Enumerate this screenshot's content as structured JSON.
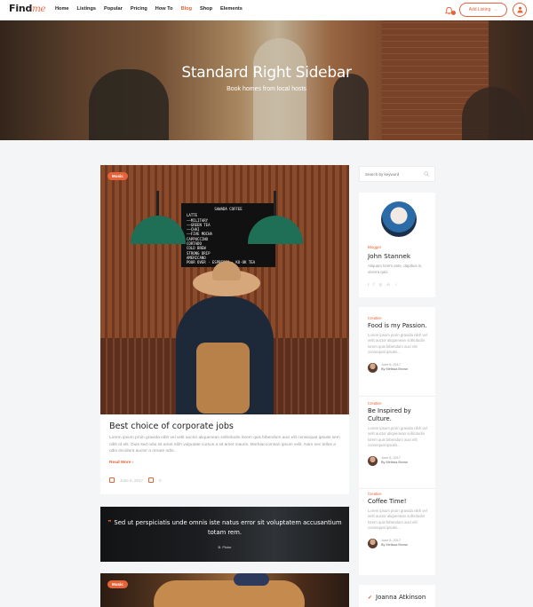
{
  "nav": {
    "logo_main": "Find",
    "logo_accent": "me",
    "items": [
      "Home",
      "Listings",
      "Popular",
      "Pricing",
      "How To",
      "Blog",
      "Shop",
      "Elements"
    ],
    "active_index": 5,
    "add_listing": "Add Listing",
    "accent": "#e4643a"
  },
  "hero": {
    "title": "Standard Right Sidebar",
    "subtitle": "Book homes from local hosts"
  },
  "posts": [
    {
      "badge": "Music",
      "title": "Best choice of corporate jobs",
      "excerpt": "Lorem ipsum proin gravida nibh vel velit auctor aliquenean sollicitudin lorem quis bibendum auci elit consequat ipsutis sem nibh id elit. Duis sed odio sit amet nibh vulputate cursus a sit amet mauris. Morbiaccumsan ipsum velit. Nam nec tellus a odio tincidunt auctor a ornare odio.",
      "read_more": "Read More",
      "date": "June 6, 2017",
      "comments": "0",
      "board_title": "SAWADA COFFEE",
      "board_lines": [
        "LATTE",
        "——MILITARY",
        "——GREEN TEA",
        "——CHAI",
        "——FIVE MOCHA",
        "CAPPUCCINO",
        "CORTADO",
        "COLD BREW",
        "STRONG DRIP",
        "AMERICANO",
        "POUR OVER · ESPRESSO · KO-OK TEA"
      ]
    }
  ],
  "quote": {
    "text": "Sed ut perspiciatis unde omnis iste natus error sit voluptatem accusantium totam rem.",
    "author": "B. Pictor"
  },
  "post3": {
    "badge": "Music"
  },
  "sidebar": {
    "search_placeholder": "Search by keyword",
    "author": {
      "role": "Blogger",
      "name": "John Stannek",
      "signature": "Jolse",
      "bio": "Aliquam lorem ante, dapibus in, viverra quis",
      "socials": [
        "t",
        "f",
        "◎",
        "in",
        "♀"
      ]
    },
    "recent": [
      {
        "category": "Creative",
        "title": "Food is my Passion.",
        "excerpt": "Lorem ipsum proin gravida nibh vel velit auctor aliquenean sollicitudin lorem quis bibendum auci elit consequat ipsutis...",
        "date": "June 6, 2017",
        "author": "By Melissa Brown"
      },
      {
        "category": "Creative",
        "title": "Be Inspired by Culture.",
        "excerpt": "Lorem ipsum proin gravida nibh vel velit auctor aliquenean sollicitudin lorem quis bibendum auci elit consequat ipsutis...",
        "date": "June 6, 2017",
        "author": "By Melissa Brown"
      },
      {
        "category": "Creative",
        "title": "Coffee Time!",
        "excerpt": "Lorem ipsum proin gravida nibh vel velit auctor aliquenean sollicitudin lorem quis bibendum auci elit consequat ipsutis...",
        "date": "June 6, 2017",
        "author": "By Melissa Brown"
      }
    ],
    "twitter_name": "Joanna Atkinson"
  }
}
